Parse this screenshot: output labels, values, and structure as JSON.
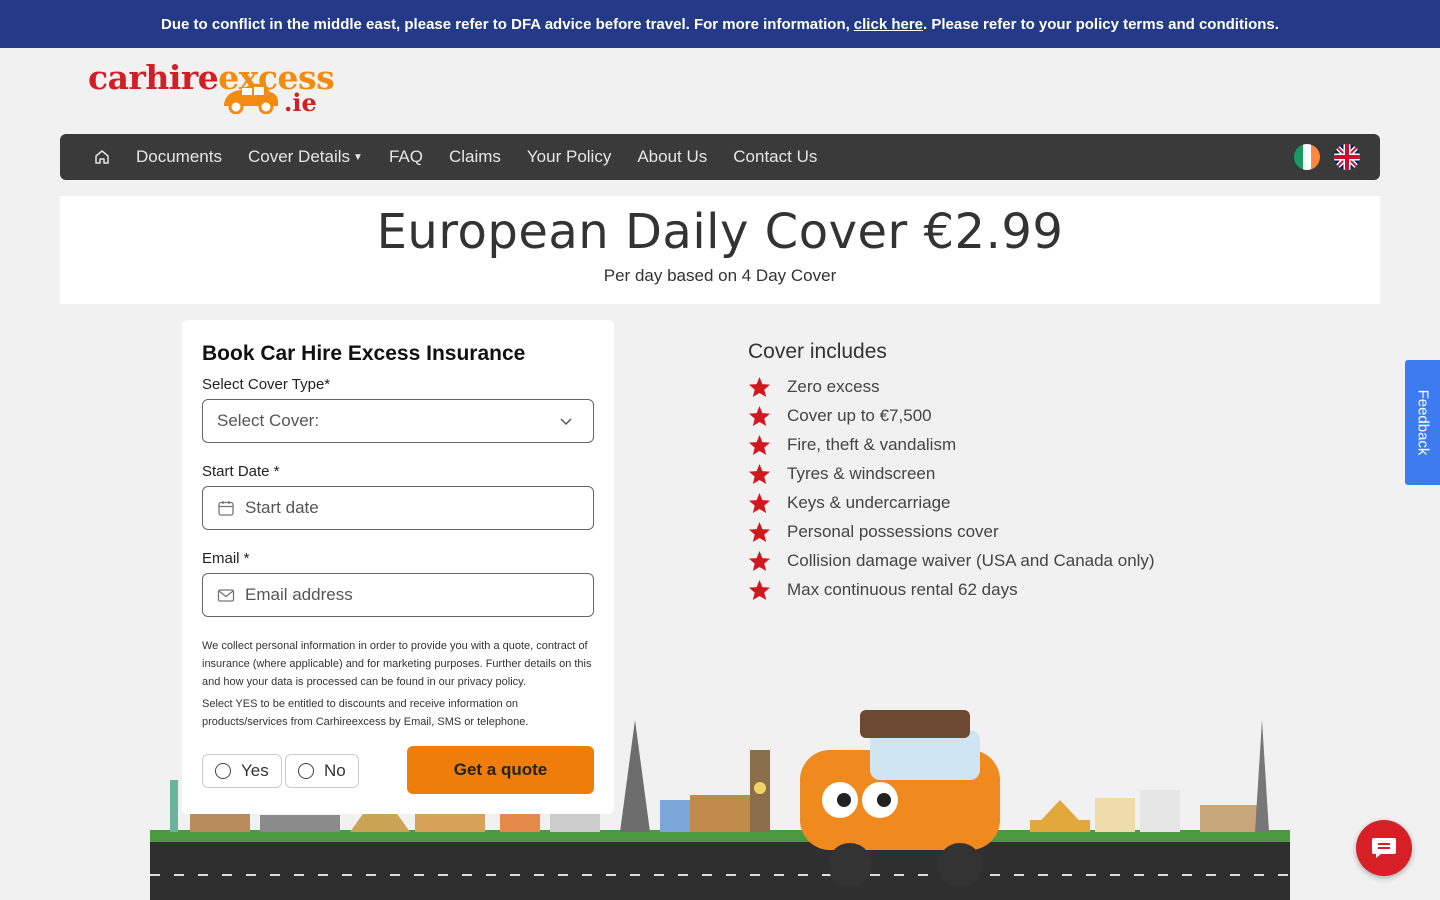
{
  "alert": {
    "text_before": "Due to conflict in the middle east, please refer to DFA advice before travel. For more information,",
    "link": "click here",
    "text_after": ". Please refer to your policy terms and conditions."
  },
  "logo": {
    "word_part1": "carhire",
    "word_part2": "excess",
    "tld": ".ie"
  },
  "nav": {
    "items": [
      {
        "label": "Documents"
      },
      {
        "label": "Cover Details"
      },
      {
        "label": "FAQ"
      },
      {
        "label": "Claims"
      },
      {
        "label": "Your Policy"
      },
      {
        "label": "About Us"
      },
      {
        "label": "Contact Us"
      }
    ]
  },
  "hero": {
    "title": "European Daily Cover €2.99",
    "subtitle": "Per day based on 4 Day Cover"
  },
  "form": {
    "title": "Book Car Hire Excess Insurance",
    "cover_type_label": "Select Cover Type*",
    "cover_type_value": "Select Cover:",
    "start_date_label": "Start Date *",
    "start_date_placeholder": "Start date",
    "email_label": "Email *",
    "email_placeholder": "Email address",
    "privacy_text": "We collect personal information in order to provide you with a quote, contract of insurance (where applicable) and for marketing purposes. Further details on this and how your data is processed can be found in our privacy policy.",
    "marketing_text": "Select YES to be entitled to discounts and receive information on products/services from Carhireexcess by Email, SMS or telephone.",
    "yes_label": "Yes",
    "no_label": "No",
    "quote_button": "Get a quote"
  },
  "cover": {
    "title": "Cover includes",
    "items": [
      "Zero excess",
      "Cover up to €7,500",
      "Fire, theft & vandalism",
      "Tyres & windscreen",
      "Keys & undercarriage",
      "Personal possessions cover",
      "Collision damage waiver (USA and Canada only)",
      "Max continuous rental 62 days"
    ]
  },
  "feedback": {
    "label": "Feedback"
  },
  "colors": {
    "alert_bg": "#243a86",
    "nav_bg": "#3a3a3a",
    "brand_red": "#d21f26",
    "brand_orange": "#ee7d0a",
    "feedback_blue": "#3d7bf0"
  }
}
